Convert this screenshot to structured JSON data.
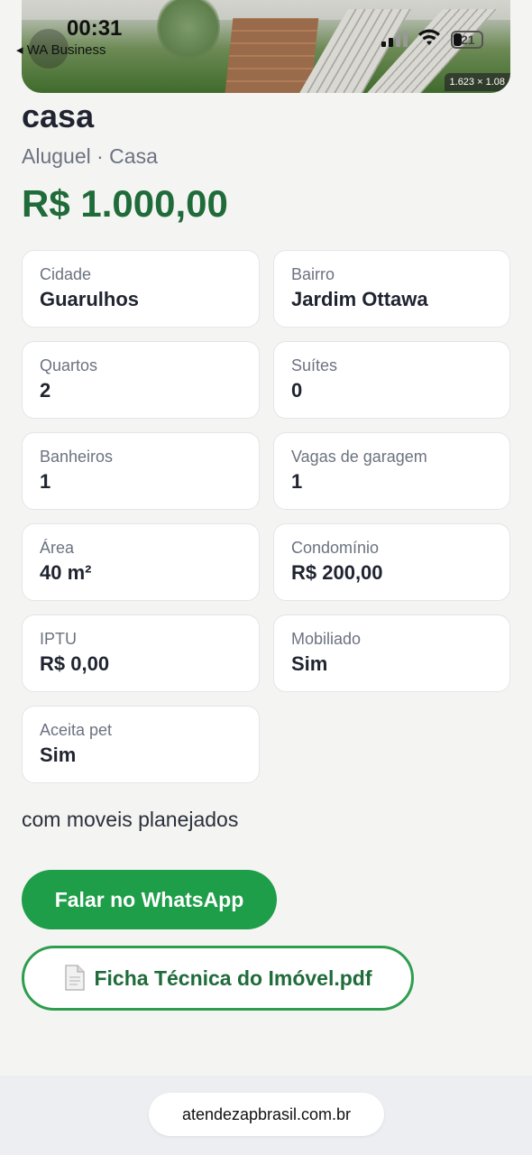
{
  "status_bar": {
    "time": "00:31",
    "back_app": "WA Business",
    "battery": "21"
  },
  "hero": {
    "image_dims": "1.623 × 1.08"
  },
  "listing": {
    "title": "casa",
    "subtitle": "Aluguel · Casa",
    "price": "R$ 1.000,00",
    "description": "com moveis planejados"
  },
  "details": [
    {
      "label": "Cidade",
      "value": "Guarulhos"
    },
    {
      "label": "Bairro",
      "value": "Jardim Ottawa"
    },
    {
      "label": "Quartos",
      "value": "2"
    },
    {
      "label": "Suítes",
      "value": "0"
    },
    {
      "label": "Banheiros",
      "value": "1"
    },
    {
      "label": "Vagas de garagem",
      "value": "1"
    },
    {
      "label": "Área",
      "value": "40 m²"
    },
    {
      "label": "Condomínio",
      "value": "R$ 200,00"
    },
    {
      "label": "IPTU",
      "value": "R$ 0,00"
    },
    {
      "label": "Mobiliado",
      "value": "Sim"
    },
    {
      "label": "Aceita pet",
      "value": "Sim"
    }
  ],
  "actions": {
    "whatsapp_label": "Falar no WhatsApp",
    "pdf_label": "Ficha Técnica do Imóvel.pdf",
    "pdf_icon": "document-icon"
  },
  "browser": {
    "url": "atendezapbrasil.com.br"
  },
  "colors": {
    "accent_green": "#1e9e48",
    "price_green": "#1f6b3a"
  }
}
